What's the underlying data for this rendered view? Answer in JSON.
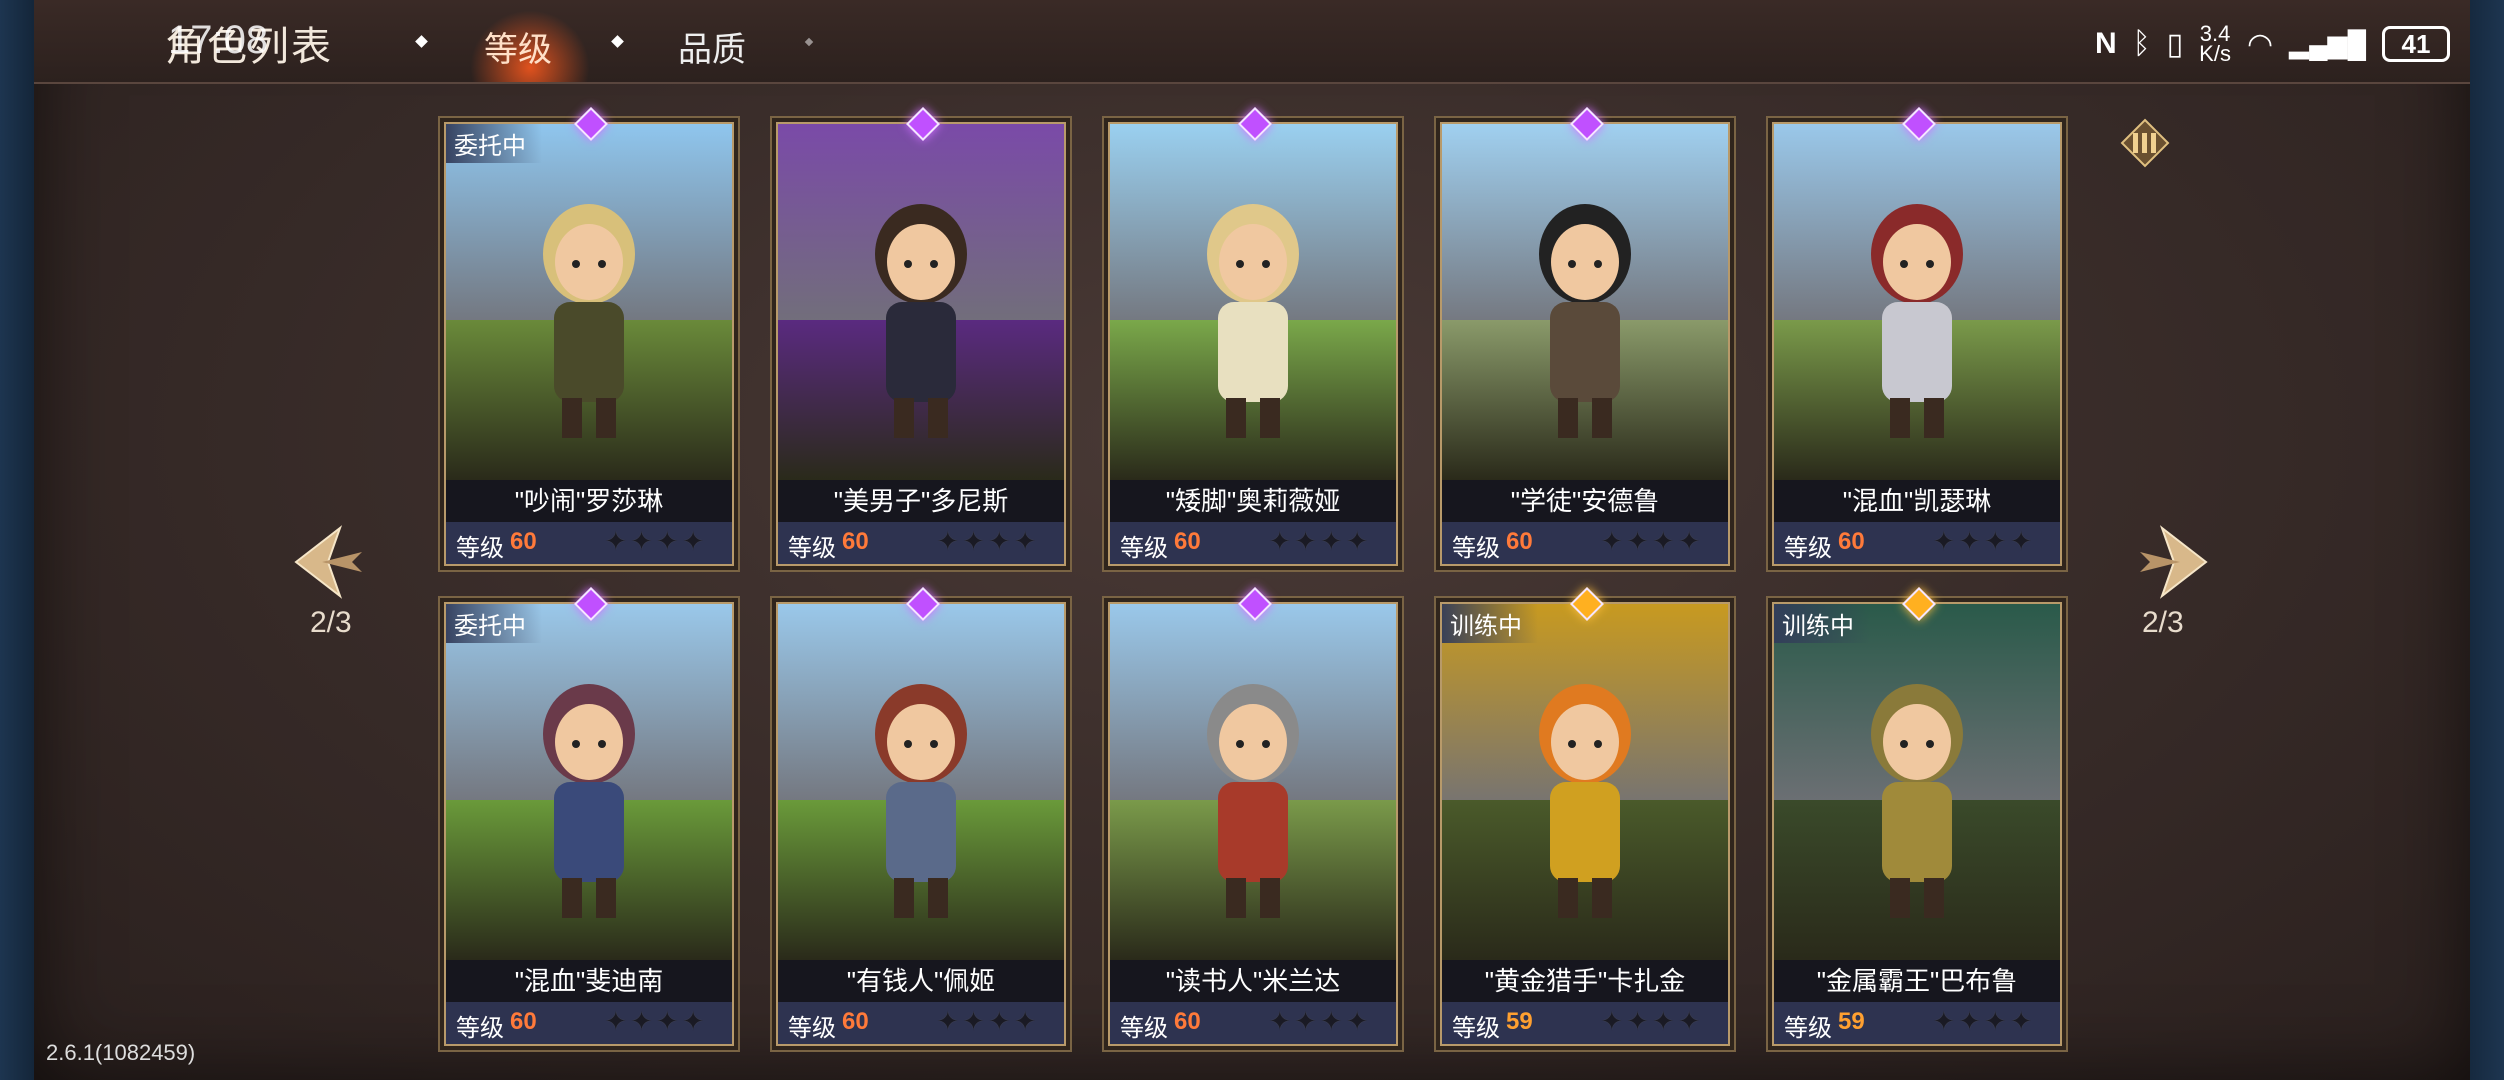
{
  "header": {
    "title": "角色列表",
    "clock": "17:08",
    "tabs": [
      {
        "label": "等级",
        "active": true
      },
      {
        "label": "品质",
        "active": false
      }
    ]
  },
  "status_bar": {
    "net_speed_value": "3.4",
    "net_speed_unit": "K/s",
    "battery": "41",
    "icons": [
      "nfc-icon",
      "bluetooth-icon",
      "vibrate-icon",
      "wifi-icon",
      "signal-icon",
      "battery-icon"
    ]
  },
  "pager": {
    "left": "2/3",
    "right": "2/3"
  },
  "cards": [
    {
      "name": "\"吵闹\"罗莎琳",
      "level_label": "等级",
      "level": "60",
      "badge": "委托中",
      "gem": "purple",
      "theme": "blonde-archer"
    },
    {
      "name": "\"美男子\"多尼斯",
      "level_label": "等级",
      "level": "60",
      "badge": "",
      "gem": "purple",
      "theme": "wizard"
    },
    {
      "name": "\"矮脚\"奥莉薇娅",
      "level_label": "等级",
      "level": "60",
      "badge": "",
      "gem": "purple",
      "theme": "priestess"
    },
    {
      "name": "\"学徒\"安德鲁",
      "level_label": "等级",
      "level": "60",
      "badge": "",
      "gem": "purple",
      "theme": "rogue"
    },
    {
      "name": "\"混血\"凯瑟琳",
      "level_label": "等级",
      "level": "60",
      "badge": "",
      "gem": "purple",
      "theme": "paladin"
    },
    {
      "name": "\"混血\"斐迪南",
      "level_label": "等级",
      "level": "60",
      "badge": "委托中",
      "gem": "purple",
      "theme": "crossbowman"
    },
    {
      "name": "\"有钱人\"佩姬",
      "level_label": "等级",
      "level": "60",
      "badge": "",
      "gem": "purple",
      "theme": "knight"
    },
    {
      "name": "\"读书人\"米兰达",
      "level_label": "等级",
      "level": "60",
      "badge": "",
      "gem": "purple",
      "theme": "mage"
    },
    {
      "name": "\"黄金猎手\"卡扎金",
      "level_label": "等级",
      "level": "59",
      "badge": "训练中",
      "gem": "gold",
      "theme": "gold-hunter"
    },
    {
      "name": "\"金属霸王\"巴布鲁",
      "level_label": "等级",
      "level": "59",
      "badge": "训练中",
      "gem": "gold",
      "theme": "metal-lord"
    }
  ],
  "stars_glyph": "✦✦✦✦",
  "version": "2.6.1(1082459)",
  "colors": {
    "level_60": "#ff7a3a",
    "level_59": "#ffa030",
    "gem_purple": "#c050ff",
    "gem_gold": "#ffb020",
    "frame": "#b89a6a"
  }
}
